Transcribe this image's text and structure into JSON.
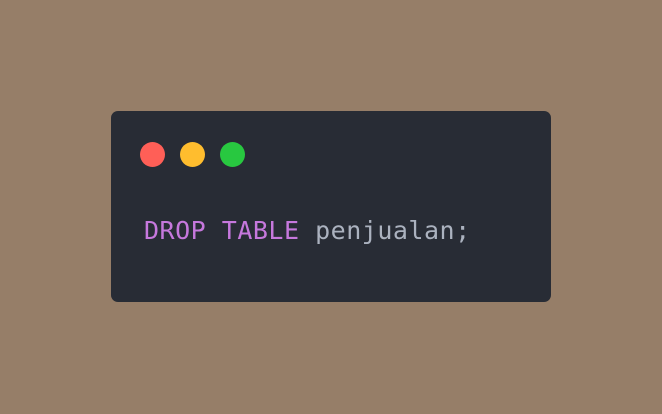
{
  "colors": {
    "background": "#967e68",
    "window": "#282c35",
    "keyword": "#c678dd",
    "identifier": "#abb2bf"
  },
  "window_controls": [
    {
      "name": "close",
      "color": "#ff5f57"
    },
    {
      "name": "minimize",
      "color": "#ffbd2e"
    },
    {
      "name": "maximize",
      "color": "#28c840"
    }
  ],
  "code": {
    "keyword_drop": "DROP",
    "keyword_table": "TABLE",
    "identifier": "penjualan",
    "terminator": ";"
  }
}
